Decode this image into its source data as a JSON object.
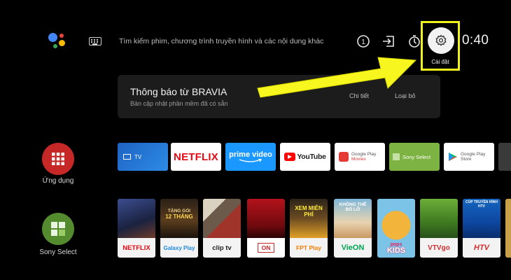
{
  "topbar": {
    "search_hint": "Tìm kiếm phim, chương trình truyền hình và các nội dung khác",
    "notification_count": "1",
    "settings_label": "Cài đặt",
    "clock": "0:40"
  },
  "notification": {
    "title": "Thông báo từ BRAVIA",
    "subtitle": "Bản cập nhật phần mềm đã có sẵn",
    "details_label": "Chi tiết",
    "dismiss_label": "Loại bỏ"
  },
  "left_rail": {
    "apps_label": "Ứng dụng",
    "sony_select_label": "Sony Select"
  },
  "app_row": {
    "tv": "TV",
    "netflix": "NETFLIX",
    "prime": "prime video",
    "youtube": "YouTube",
    "gp_movies_1": "Google Play",
    "gp_movies_2": "Movies",
    "sony_select": "Sony Select",
    "gp_store_1": "Google Play",
    "gp_store_2": "Store"
  },
  "content_row": {
    "netflix": "NETFLIX",
    "galaxy_top_1": "TẶNG GÓI",
    "galaxy_top_2": "12 THÁNG",
    "galaxy": "Galaxy Play",
    "cliptv": "clip tv",
    "on_top": "XEM MIỄN PHÍ",
    "on": "ON",
    "fpt": "FPT Play",
    "vieon_top_1": "KHÔNG THỂ",
    "vieon_top_2": "BỎ LỠ",
    "vieon": "VieON",
    "pops_kids_1": "pops",
    "pops_kids_2": "KIDS",
    "vtvgo": "VTVgo",
    "htv_top": "CÚP TRUYỀN HÌNH HTV",
    "htv": "HTV"
  },
  "colors": {
    "highlight": "#f2f21b",
    "netflix_red": "#e50914",
    "apps_red": "#c62828",
    "sony_green": "#558b2f"
  }
}
